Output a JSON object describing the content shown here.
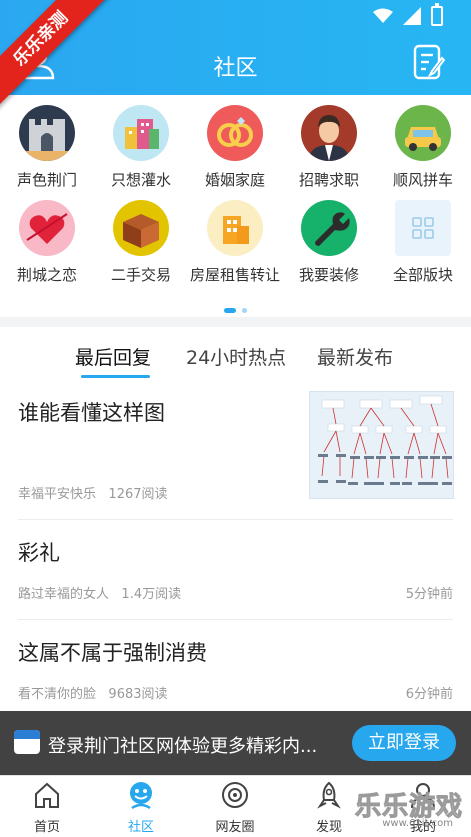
{
  "header": {
    "title": "社区"
  },
  "corner_ribbon": "乐乐亲测",
  "categories": [
    {
      "label": "声色荆门",
      "icon": "castle-gate-icon"
    },
    {
      "label": "只想灌水",
      "icon": "city-building-icon"
    },
    {
      "label": "婚姻家庭",
      "icon": "wedding-rings-icon"
    },
    {
      "label": "招聘求职",
      "icon": "businessman-icon"
    },
    {
      "label": "顺风拼车",
      "icon": "car-icon"
    },
    {
      "label": "荆城之恋",
      "icon": "heart-icon"
    },
    {
      "label": "二手交易",
      "icon": "box-icon"
    },
    {
      "label": "房屋租售转让",
      "icon": "house-icon"
    },
    {
      "label": "我要装修",
      "icon": "wrench-icon"
    },
    {
      "label": "全部版块",
      "icon": "grid-icon"
    }
  ],
  "tabs": [
    {
      "label": "最后回复",
      "active": true
    },
    {
      "label": "24小时热点",
      "active": false
    },
    {
      "label": "最新发布",
      "active": false
    }
  ],
  "posts": [
    {
      "title": "谁能看懂这样图",
      "author": "幸福平安快乐",
      "views": "1267阅读",
      "time": "",
      "has_image": true
    },
    {
      "title": "彩礼",
      "author": "路过幸福的女人",
      "views": "1.4万阅读",
      "time": "5分钟前"
    },
    {
      "title": "这属不属于强制消费",
      "author": "看不清你的脸",
      "views": "9683阅读",
      "time": "6分钟前"
    }
  ],
  "banner": {
    "text": "登录荆门社区网体验更多精彩内...",
    "button": "立即登录"
  },
  "nav": [
    {
      "label": "首页",
      "icon": "home-icon",
      "active": false
    },
    {
      "label": "社区",
      "icon": "community-icon",
      "active": true
    },
    {
      "label": "网友圈",
      "icon": "camera-circle-icon",
      "active": false
    },
    {
      "label": "发现",
      "icon": "rocket-icon",
      "active": false
    },
    {
      "label": "我的",
      "icon": "profile-icon",
      "active": false
    }
  ],
  "watermark": {
    "text": "乐乐游戏",
    "url": "www.61it.com"
  },
  "colors": {
    "accent": "#27a7ee",
    "header": "#2aa7f0",
    "ribbon": "#e2241c"
  }
}
